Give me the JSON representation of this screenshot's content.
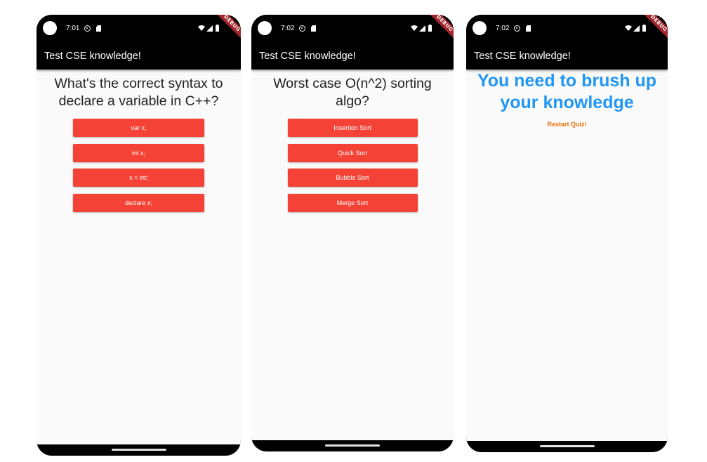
{
  "app": {
    "title": "Test CSE knowledge!",
    "debug_label": "DEBUG"
  },
  "screens": [
    {
      "time": "7:01",
      "question": "What's the correct syntax to declare a variable in C++?",
      "answers": [
        "var x;",
        "int x;",
        "x = int;",
        "declare x;"
      ]
    },
    {
      "time": "7:02",
      "question": "Worst case O(n^2) sorting algo?",
      "answers": [
        "Insertion Sort",
        "Quick Sort",
        "Bubble Sort",
        "Merge Sort"
      ]
    },
    {
      "time": "7:02",
      "result": "You need to brush up your knowledge",
      "restart_label": "Restart Quiz!"
    }
  ],
  "colors": {
    "answer_button": "#f44336",
    "result_text": "#2196f3",
    "restart_text": "#ef6c00",
    "app_bar": "#000000"
  },
  "icons": [
    "camera-cutout-icon",
    "settings-icon",
    "sd-card-icon",
    "wifi-icon",
    "signal-icon",
    "battery-icon"
  ]
}
